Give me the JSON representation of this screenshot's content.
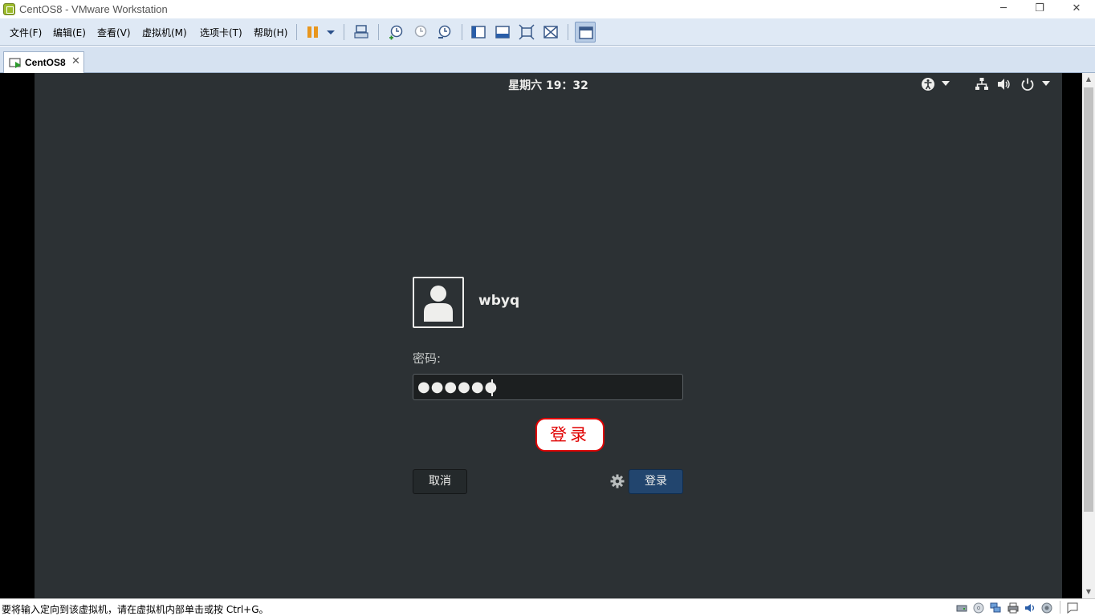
{
  "window": {
    "title": "CentOS8 - VMware Workstation",
    "minimize": "─",
    "restore": "❐",
    "close": "✕"
  },
  "menu": {
    "items": [
      "文件(F)",
      "编辑(E)",
      "查看(V)",
      "虚拟机(M)",
      "选项卡(T)",
      "帮助(H)"
    ]
  },
  "tab": {
    "label": "CentOS8",
    "close": "✕"
  },
  "guest": {
    "clock": "星期六 19：32",
    "user": "wbyq",
    "password_label": "密码:",
    "password_mask": "●●●●●●",
    "callout": "登录",
    "cancel_label": "取消",
    "login_label": "登录"
  },
  "scrollbar": {
    "up": "▲",
    "down": "▼"
  },
  "status": {
    "message": "要将输入定向到该虚拟机，请在虚拟机内部单击或按 Ctrl+G。"
  },
  "colors": {
    "guest_bg": "#2c3134",
    "login_button": "#22456e",
    "callout_red": "#e00000",
    "toolbar_bg": "#dfe9f5"
  }
}
